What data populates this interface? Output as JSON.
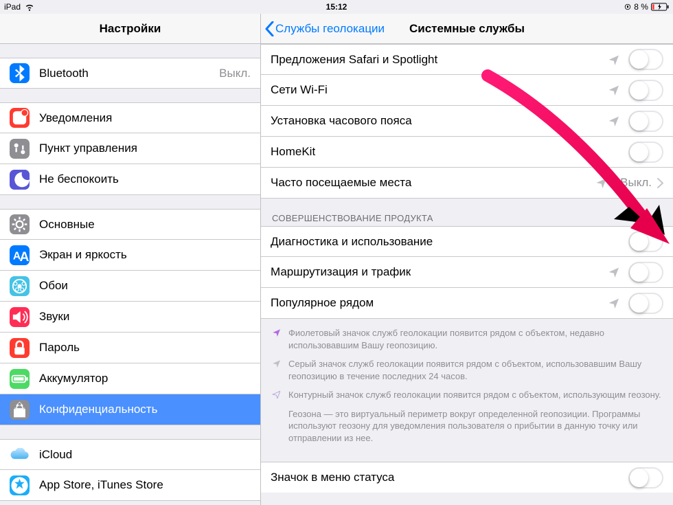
{
  "status": {
    "device": "iPad",
    "time": "15:12",
    "battery_pct": "8 %",
    "battery_color": "#ff3b30"
  },
  "sidebar": {
    "title": "Настройки",
    "groups": [
      [
        {
          "icon": "bluetooth",
          "bg": "#007aff",
          "label": "Bluetooth",
          "value": "Выкл."
        }
      ],
      [
        {
          "icon": "notifications",
          "bg": "#ff3b30",
          "label": "Уведомления"
        },
        {
          "icon": "control-center",
          "bg": "#8e8e93",
          "label": "Пункт управления"
        },
        {
          "icon": "dnd",
          "bg": "#5856d6",
          "label": "Не беспокоить"
        }
      ],
      [
        {
          "icon": "general",
          "bg": "#8e8e93",
          "label": "Основные"
        },
        {
          "icon": "display",
          "bg": "#007aff",
          "label": "Экран и яркость"
        },
        {
          "icon": "wallpaper",
          "bg": "#44c3e6",
          "label": "Обои"
        },
        {
          "icon": "sounds",
          "bg": "#ff2d55",
          "label": "Звуки"
        },
        {
          "icon": "passcode",
          "bg": "#ff3b30",
          "label": "Пароль"
        },
        {
          "icon": "battery",
          "bg": "#4cd964",
          "label": "Аккумулятор"
        },
        {
          "icon": "privacy",
          "bg": "#8e8e93",
          "label": "Конфиденциальность",
          "active": true
        }
      ],
      [
        {
          "icon": "icloud",
          "bg": "",
          "label": "iCloud",
          "sublabel": ""
        },
        {
          "icon": "appstore",
          "bg": "#1badf8",
          "label": "App Store, iTunes Store"
        }
      ]
    ]
  },
  "detail": {
    "back_label": "Службы геолокации",
    "title": "Системные службы",
    "groups": [
      {
        "header": "",
        "rows": [
          {
            "label": "Предложения Safari и Spotlight",
            "loc": "gray",
            "control": "toggle"
          },
          {
            "label": "Сети Wi-Fi",
            "loc": "gray",
            "control": "toggle"
          },
          {
            "label": "Установка часового пояса",
            "loc": "gray",
            "control": "toggle"
          },
          {
            "label": "HomeKit",
            "loc": "",
            "control": "toggle"
          },
          {
            "label": "Часто посещаемые места",
            "loc": "gray",
            "control": "nav",
            "value": "Выкл."
          }
        ]
      },
      {
        "header": "СОВЕРШЕНСТВОВАНИЕ ПРОДУКТА",
        "rows": [
          {
            "label": "Диагностика и использование",
            "loc": "",
            "control": "toggle"
          },
          {
            "label": "Маршрутизация и трафик",
            "loc": "gray",
            "control": "toggle"
          },
          {
            "label": "Популярное рядом",
            "loc": "gray",
            "control": "toggle"
          }
        ]
      }
    ],
    "footer": {
      "purple": "Фиолетовый значок служб геолокации появится рядом с объектом, недавно использовавшим Вашу геопозицию.",
      "gray": "Серый значок служб геолокации появится рядом с объектом, использовавшим Вашу геопозицию в течение последних 24 часов.",
      "outline": "Контурный значок служб геолокации появится рядом с объектом, использующим геозону.",
      "geofence": "Геозона — это виртуальный периметр вокруг определенной геопозиции. Программы используют геозону для уведомления пользователя о прибытии в данную точку или отправлении из нее."
    },
    "last_group_hint": "Значок в меню статуса"
  }
}
